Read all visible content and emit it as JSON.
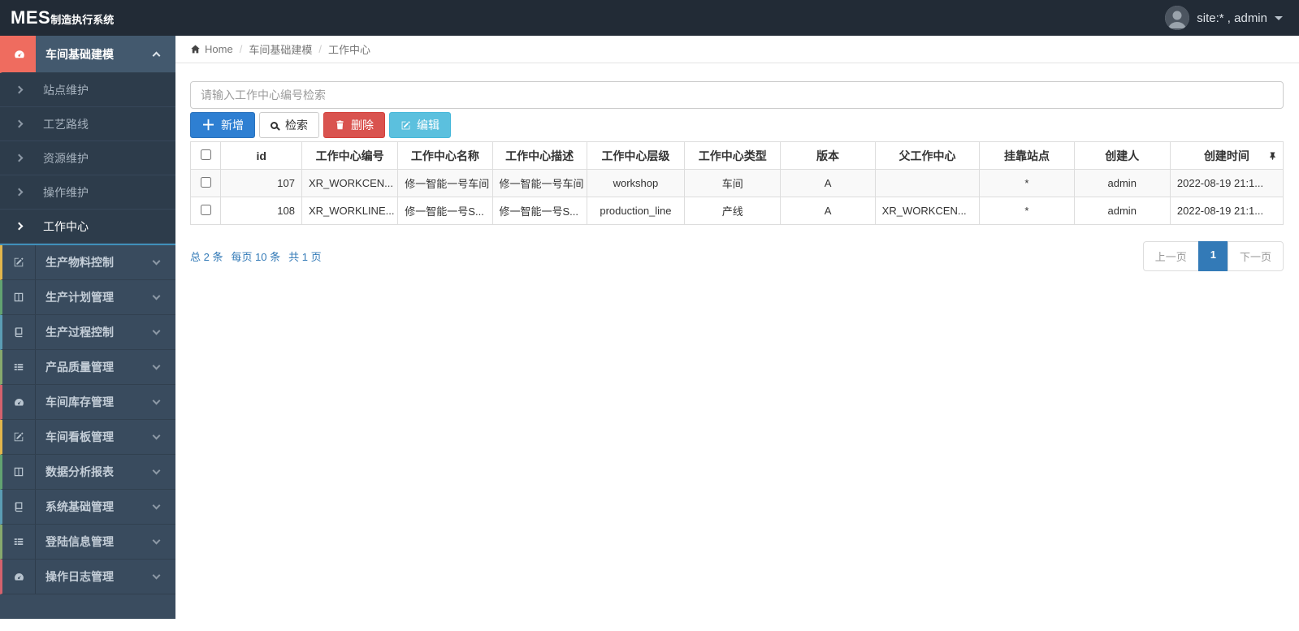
{
  "topbar": {
    "logo_primary": "MES",
    "logo_secondary": "制造执行系统",
    "user_label": "site:* , admin"
  },
  "breadcrumb": {
    "home": "Home",
    "section": "车间基础建模",
    "current": "工作中心"
  },
  "sidebar": {
    "groups": [
      {
        "label": "车间基础建模",
        "icon": "gauge-icon",
        "accent": "#ef6c5f",
        "active": true,
        "expanded": true,
        "children": [
          {
            "label": "站点维护"
          },
          {
            "label": "工艺路线"
          },
          {
            "label": "资源维护"
          },
          {
            "label": "操作维护"
          },
          {
            "label": "工作中心",
            "active": true
          }
        ]
      },
      {
        "label": "生产物料控制",
        "icon": "pencil-square-icon",
        "accent": "#e2b64c"
      },
      {
        "label": "生产计划管理",
        "icon": "columns-icon",
        "accent": "#62a371"
      },
      {
        "label": "生产过程控制",
        "icon": "book-icon",
        "accent": "#5b9db4"
      },
      {
        "label": "产品质量管理",
        "icon": "list-icon",
        "accent": "#87a96d"
      },
      {
        "label": "车间库存管理",
        "icon": "gauge-icon",
        "accent": "#d5626d"
      },
      {
        "label": "车间看板管理",
        "icon": "pencil-square-icon",
        "accent": "#e2b64c"
      },
      {
        "label": "数据分析报表",
        "icon": "columns-icon",
        "accent": "#62a371"
      },
      {
        "label": "系统基础管理",
        "icon": "book-icon",
        "accent": "#5b9db4"
      },
      {
        "label": "登陆信息管理",
        "icon": "list-icon",
        "accent": "#87a96d"
      },
      {
        "label": "操作日志管理",
        "icon": "gauge-icon",
        "accent": "#d5626d"
      }
    ]
  },
  "toolbar": {
    "search_placeholder": "请输入工作中心编号检索",
    "add_label": "新增",
    "search_label": "检索",
    "delete_label": "删除",
    "edit_label": "编辑"
  },
  "table": {
    "columns": [
      "id",
      "工作中心编号",
      "工作中心名称",
      "工作中心描述",
      "工作中心层级",
      "工作中心类型",
      "版本",
      "父工作中心",
      "挂靠站点",
      "创建人",
      "创建时间"
    ],
    "rows": [
      [
        "107",
        "XR_WORKCEN...",
        "修一智能一号车间",
        "修一智能一号车间",
        "workshop",
        "车间",
        "A",
        "",
        "*",
        "admin",
        "2022-08-19 21:1..."
      ],
      [
        "108",
        "XR_WORKLINE...",
        "修一智能一号S...",
        "修一智能一号S...",
        "production_line",
        "产线",
        "A",
        "XR_WORKCEN...",
        "*",
        "admin",
        "2022-08-19 21:1..."
      ]
    ]
  },
  "pagination": {
    "summary_total": "总 2 条",
    "summary_per_page": "每页 10 条",
    "summary_pages": "共 1 页",
    "prev_label": "上一页",
    "current_page": "1",
    "next_label": "下一页"
  },
  "colors": {
    "topbar_bg": "#222b36",
    "sidebar_bg": "#3a4c5f",
    "primary_button": "#2e7fd2",
    "danger_button": "#d9534f",
    "info_button": "#5bc0de",
    "pagination_active": "#337ab7",
    "summary_text": "#337ab7"
  }
}
